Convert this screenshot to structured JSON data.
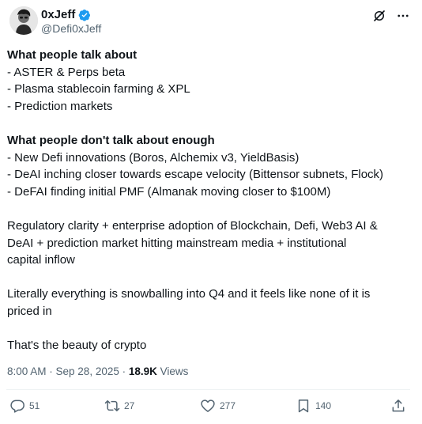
{
  "author": {
    "display_name": "0xJeff",
    "handle": "@Defi0xJeff",
    "verified_color": "#1d9bf0"
  },
  "header_icons": [
    "grok-icon",
    "more-icon"
  ],
  "tweet": {
    "section1_title": "What people talk about",
    "section1_items": [
      "- ASTER & Perps beta",
      "- Plasma stablecoin farming & XPL",
      "- Prediction markets"
    ],
    "section2_title": "What people don't talk about enough",
    "section2_items": [
      "- New Defi innovations (Boros, Alchemix v3, YieldBasis)",
      "- DeAI inching closer towards escape velocity (Bittensor subnets, Flock)",
      "- DeFAI finding initial PMF (Almanak moving closer to $100M)"
    ],
    "para1_line1": "Regulatory clarity + enterprise adoption of Blockchain, Defi, Web3 AI &",
    "para1_line2": "DeAI + prediction market hitting mainstream media + institutional",
    "para1_line3": "capital inflow",
    "para2_line1": "Literally everything is snowballing into Q4 and it feels like none of it is",
    "para2_line2": "priced in",
    "para3": "That's the beauty of crypto"
  },
  "meta": {
    "time": "8:00 AM",
    "separator": " · ",
    "date": "Sep 28, 2025",
    "views_count": "18.9K",
    "views_label": "Views"
  },
  "actions": {
    "replies": "51",
    "reposts": "27",
    "likes": "277",
    "bookmarks": "140"
  },
  "colors": {
    "text": "#0f1419",
    "secondary": "#536471",
    "divider": "#eff3f4",
    "verified": "#1d9bf0"
  }
}
